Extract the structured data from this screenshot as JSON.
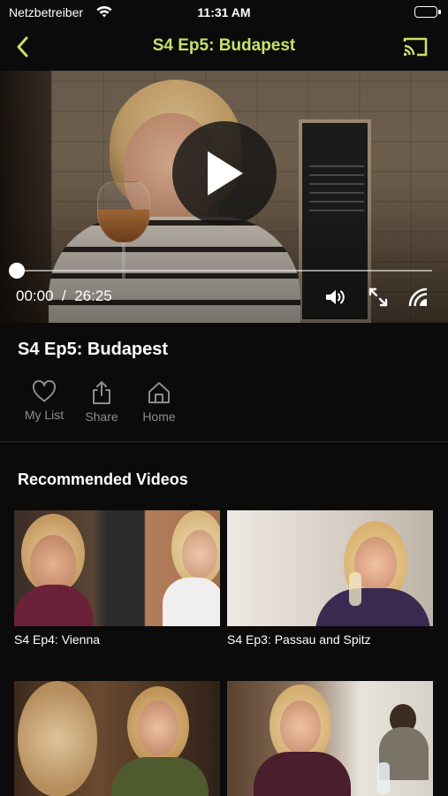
{
  "status_bar": {
    "carrier": "Netzbetreiber",
    "time": "11:31 AM",
    "icons": [
      "wifi-icon",
      "battery-icon"
    ]
  },
  "nav": {
    "title": "S4 Ep5: Budapest",
    "title_color": "#c8e06b",
    "back_icon": "chevron-left-icon",
    "cast_icon": "cast-icon"
  },
  "player": {
    "current_time": "00:00",
    "separator": "/",
    "duration": "26:25",
    "progress_fraction": 0,
    "icons": [
      "play-icon",
      "volume-icon",
      "fullscreen-icon",
      "airplay-icon"
    ]
  },
  "episode": {
    "title": "S4 Ep5: Budapest"
  },
  "actions": [
    {
      "label": "My List",
      "icon": "heart-icon"
    },
    {
      "label": "Share",
      "icon": "share-icon"
    },
    {
      "label": "Home",
      "icon": "home-icon"
    }
  ],
  "recommended": {
    "title": "Recommended Videos",
    "items": [
      {
        "caption": "S4 Ep4: Vienna"
      },
      {
        "caption": "S4 Ep3: Passau and Spitz"
      },
      {
        "caption": ""
      },
      {
        "caption": ""
      }
    ]
  },
  "colors": {
    "background": "#0b0b0b",
    "accent": "#c8e06b",
    "secondary_text": "#8c8c8c"
  }
}
